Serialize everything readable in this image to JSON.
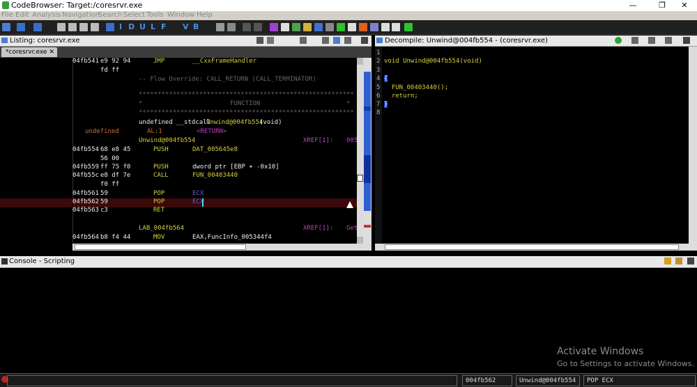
{
  "window": {
    "title": "CodeBrowser: Target:/coresrvr.exe",
    "minimize": "—",
    "restore": "❐",
    "close": "✕"
  },
  "menu": [
    "File",
    "Edit",
    "Analysis",
    "Navigation",
    "Search",
    "Select",
    "Tools",
    "Window",
    "Help"
  ],
  "toolbar": {
    "letters": [
      "I",
      "D",
      "U",
      "L",
      "F",
      "V",
      "B"
    ]
  },
  "listing": {
    "title": "Listing: coresrvr.exe",
    "tab": "*coresrvr.exe",
    "lines": [
      {
        "addr": "04fb541",
        "bytes": "e9 92 94",
        "mnem": "JMP",
        "op": "__CxxFrameHandler"
      },
      {
        "addr": "",
        "bytes": "fd ff",
        "mnem": "",
        "op": ""
      },
      {
        "comment": "-- Flow Override: CALL_RETURN (CALL_TERMINATOR)"
      },
      {
        "stars": "*********************************************************"
      },
      {
        "star_label": "FUNCTION"
      },
      {
        "stars": "*********************************************************"
      },
      {
        "sig_pre": "undefined __stdcall ",
        "sig_fn": "Unwind@004fb554",
        "sig_post": "(void)"
      },
      {
        "ret_type": "undefined",
        "ret_reg": "AL:1",
        "ret_tag": "<RETURN>"
      },
      {
        "label": "Unwind@004fb554",
        "xref": "XREF[1]:",
        "xref_val": "005"
      },
      {
        "addr": "04fb554",
        "bytes": "68 e8 45",
        "mnem": "PUSH",
        "op": "DAT_005645e8"
      },
      {
        "addr": "",
        "bytes": "56 00",
        "mnem": "",
        "op": ""
      },
      {
        "addr": "04fb559",
        "bytes": "ff 75 f0",
        "mnem": "PUSH",
        "op": "dword ptr [EBP + -0x10]"
      },
      {
        "addr": "04fb55c",
        "bytes": "e8 df 7e",
        "mnem": "CALL",
        "op": "FUN_00403440"
      },
      {
        "addr": "",
        "bytes": "f0 ff",
        "mnem": "",
        "op": ""
      },
      {
        "addr": "04fb561",
        "bytes": "59",
        "mnem": "POP",
        "op": "ECX"
      },
      {
        "addr": "04fb562",
        "bytes": "59",
        "mnem": "POP",
        "op": "ECX"
      },
      {
        "addr": "04fb563",
        "bytes": "c3",
        "mnem": "RET",
        "op": ""
      },
      {
        "blank": ""
      },
      {
        "label": "LAB_004fb564",
        "xref": "XREF[1]:",
        "xref_val": "Get"
      },
      {
        "addr": "04fb564",
        "bytes": "b8 f4 44",
        "mnem": "MOV",
        "op": "EAX,FuncInfo_005344f4"
      }
    ]
  },
  "decompile": {
    "title": "Decompile: Unwind@004fb554 -  (coresrvr.exe)",
    "lines": [
      {
        "n": "1",
        "code": ""
      },
      {
        "n": "2",
        "code": "void Unwind@004fb554(void)"
      },
      {
        "n": "3",
        "code": ""
      },
      {
        "n": "4",
        "code": "{"
      },
      {
        "n": "5",
        "code": "  FUN_00403440();"
      },
      {
        "n": "6",
        "code": "  return;"
      },
      {
        "n": "7",
        "code": "}"
      },
      {
        "n": "8",
        "code": ""
      }
    ]
  },
  "console": {
    "title": "Console - Scripting"
  },
  "watermark": {
    "line1": "Activate Windows",
    "line2": "Go to Settings to activate Windows."
  },
  "status": {
    "address": "004fb562",
    "function": "Unwind@004fb554",
    "instruction": "POP ECX"
  }
}
